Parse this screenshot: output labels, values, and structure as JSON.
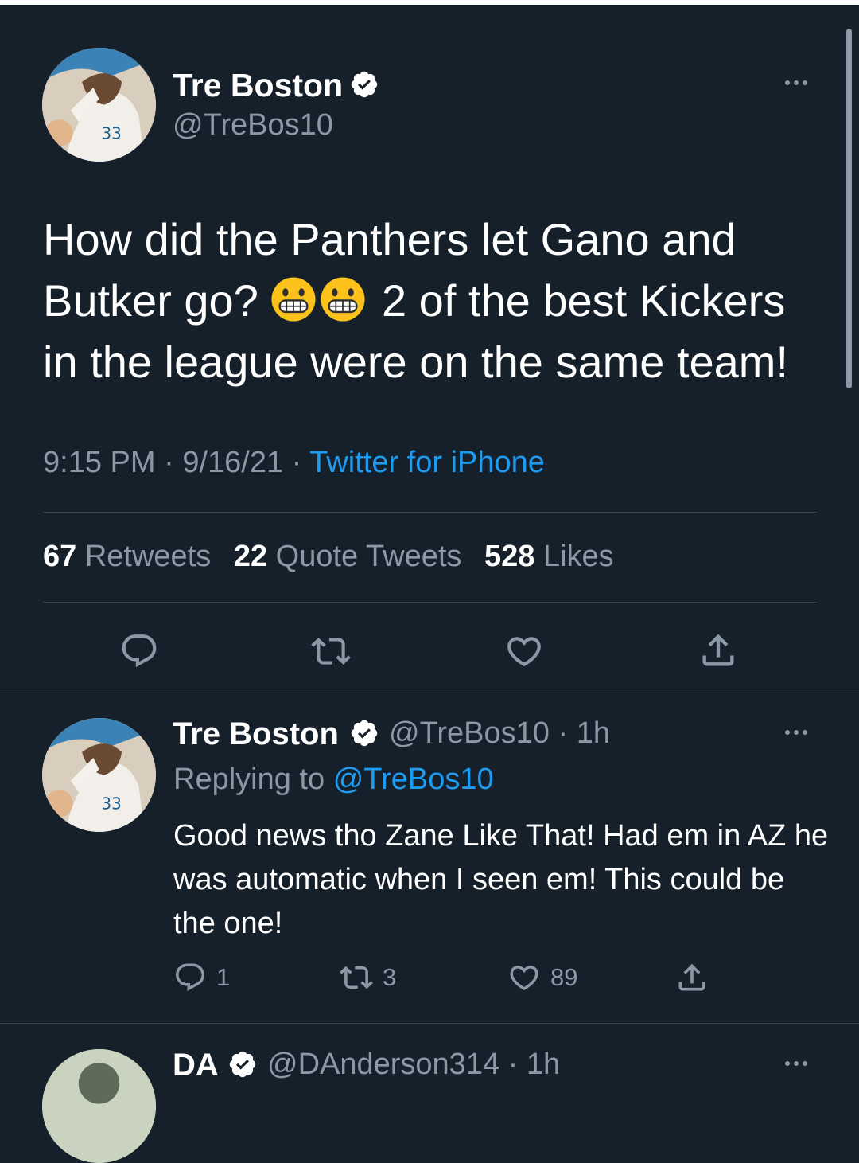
{
  "main_tweet": {
    "author_name": "Tre Boston",
    "author_handle": "@TreBos10",
    "text_part1": "How did the Panthers let Gano and Butker go?",
    "text_part2": "2 of the best Kickers in the league were on the same team!",
    "emojis": [
      "grimacing-face",
      "grimacing-face"
    ],
    "time": "9:15 PM",
    "date": "9/16/21",
    "source": "Twitter for iPhone",
    "retweets_count": "67",
    "retweets_label": "Retweets",
    "quotes_count": "22",
    "quotes_label": "Quote Tweets",
    "likes_count": "528",
    "likes_label": "Likes"
  },
  "reply_tweet": {
    "author_name": "Tre Boston",
    "author_handle": "@TreBos10",
    "time_ago": "1h",
    "replying_label": "Replying to",
    "replying_to": "@TreBos10",
    "text": "Good news tho Zane Like That! Had em in AZ he was automatic when I seen em! This could be the one!",
    "reply_count": "1",
    "retweet_count": "3",
    "like_count": "89"
  },
  "next_tweet": {
    "author_name": "DA",
    "author_handle": "@DAnderson314",
    "time_ago": "1h"
  },
  "separator": "·",
  "icons": [
    "verified-badge-icon",
    "more-icon",
    "reply-icon",
    "retweet-icon",
    "like-icon",
    "share-icon"
  ],
  "colors": {
    "background": "#15202b",
    "text": "#ffffff",
    "secondary_text": "#8b98a5",
    "link": "#1d9bf0",
    "divider": "#38444d"
  }
}
